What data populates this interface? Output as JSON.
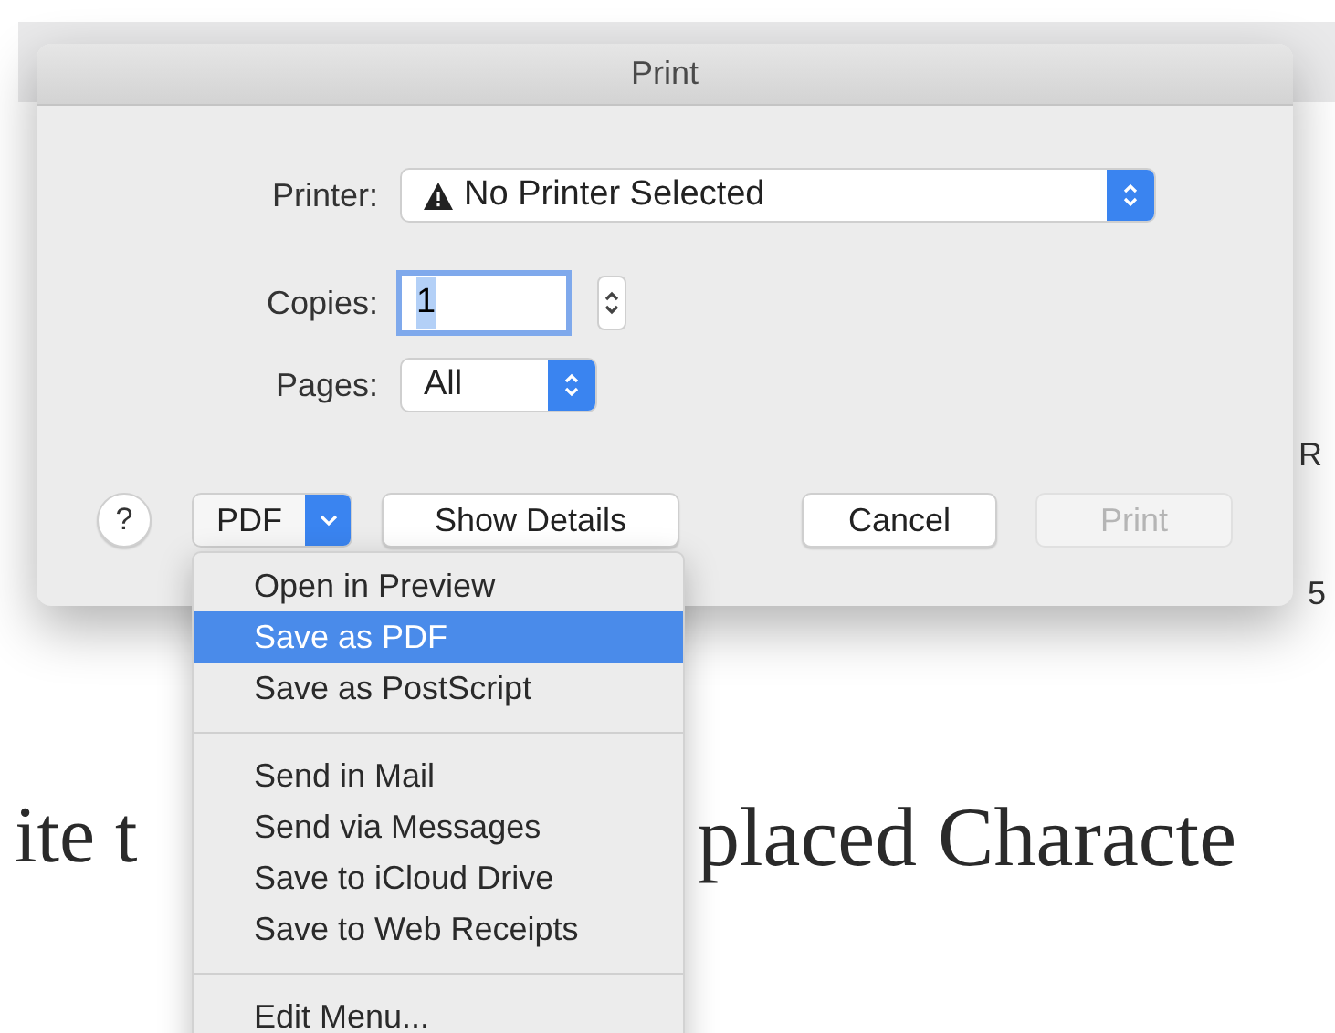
{
  "window": {
    "title": "Print"
  },
  "form": {
    "printer": {
      "label": "Printer:",
      "value": "No Printer Selected",
      "warning": true
    },
    "copies": {
      "label": "Copies:",
      "value": "1",
      "focused": true
    },
    "pages": {
      "label": "Pages:",
      "value": "All"
    }
  },
  "buttons": {
    "help": "?",
    "pdf": "PDF",
    "details": {
      "label": "Show Details",
      "disabled": false
    },
    "cancel": {
      "label": "Cancel",
      "disabled": false
    },
    "print": {
      "label": "Print",
      "disabled": true
    }
  },
  "menu": {
    "sections": [
      {
        "items": [
          {
            "label": "Open in Preview",
            "selected": false
          },
          {
            "label": "Save as PDF",
            "selected": true
          },
          {
            "label": "Save as PostScript",
            "selected": false
          }
        ]
      },
      {
        "items": [
          {
            "label": "Send in Mail",
            "selected": false
          },
          {
            "label": "Send via Messages",
            "selected": false
          },
          {
            "label": "Save to iCloud Drive",
            "selected": false
          },
          {
            "label": "Save to Web Receipts",
            "selected": false
          }
        ]
      },
      {
        "items": [
          {
            "label": "Edit Menu...",
            "selected": false
          }
        ]
      }
    ]
  },
  "background": {
    "heading_parts": [
      "ite t",
      "placed Characte"
    ],
    "fragments": [
      "R",
      "5"
    ]
  }
}
